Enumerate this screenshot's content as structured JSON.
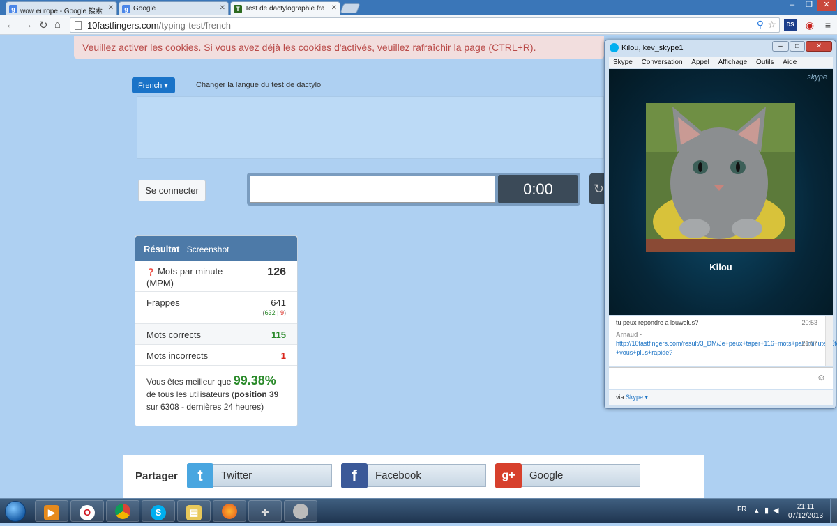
{
  "browser": {
    "tabs": [
      {
        "title": "wow europe - Google 搜索",
        "favicon": "g"
      },
      {
        "title": "Google",
        "favicon": "g"
      },
      {
        "title": "Test de dactylographie fra",
        "favicon": "T"
      }
    ],
    "url_domain": "10fastfingers.com",
    "url_path": "/typing-test/french",
    "window_controls": {
      "minimize": "–",
      "restore": "❐",
      "close": "✕"
    },
    "toolbar_icons": {
      "star": "☆",
      "ext1": "DS",
      "menu": "≡"
    }
  },
  "page": {
    "cookie_warning": "Veuillez activer les cookies. Si vous avez déjà les cookies d'activés, veuillez rafraîchir la page (CTRL+R).",
    "language_button": "French ▾",
    "language_text": "Changer la langue du test de dactylo",
    "login_button": "Se connecter",
    "timer": "0:00",
    "typing_input_value": "",
    "result": {
      "title": "Résultat",
      "screenshot_label": "Screenshot",
      "wpm_label": "Mots par minute (MPM)",
      "wpm_value": "126",
      "keys_label": "Frappes",
      "keys_value": "641",
      "keys_correct": "632",
      "keys_wrong": "9",
      "correct_label": "Mots corrects",
      "correct_value": "115",
      "wrong_label": "Mots incorrects",
      "wrong_value": "1",
      "summary_prefix": "Vous êtes meilleur que",
      "summary_pct": "99.38%",
      "summary_mid": "de tous les utilisateurs (",
      "summary_pos": "position 39",
      "summary_rest": "sur 6308 - dernières 24 heures)"
    },
    "share": {
      "label": "Partager",
      "twitter": "Twitter",
      "facebook": "Facebook",
      "google": "Google"
    }
  },
  "skype": {
    "title": "Kilou, kev_skype1",
    "menu": [
      "Skype",
      "Conversation",
      "Appel",
      "Affichage",
      "Outils",
      "Aide"
    ],
    "logo": "skype",
    "contact_name": "Kilou",
    "messages": [
      {
        "text": "tu peux repondre a louwelus?",
        "time": "20:53"
      },
      {
        "sender": "Arnaud -",
        "link": "http://10fastfingers.com/result/3_DM/Je+peux+taper+116+mots+par+minute+Êtes+-+vous+plus+rapide?",
        "time": "21:07"
      }
    ],
    "via_label": "via",
    "via_link": "Skype ▾",
    "controls": {
      "minimize": "–",
      "restore": "□",
      "close": "✕"
    }
  },
  "taskbar": {
    "lang": "FR",
    "time": "21:11",
    "date": "07/12/2013"
  },
  "colors": {
    "page_bg": "#aed0f2",
    "brand_blue": "#1a73c8",
    "correct_green": "#2a8a2a",
    "wrong_red": "#d9261c",
    "timer_bg": "#3b4a58"
  }
}
